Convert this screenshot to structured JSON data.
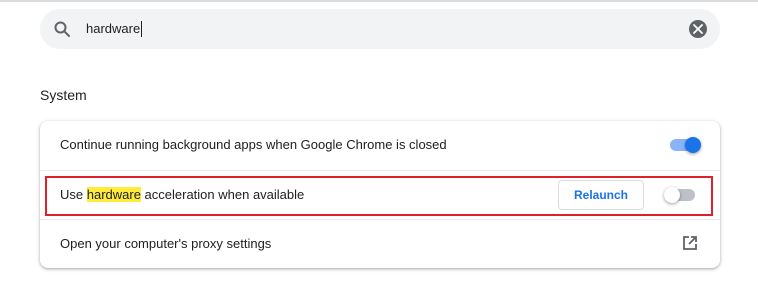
{
  "search": {
    "value": "hardware",
    "icon": "search-icon",
    "clear_icon": "close-icon"
  },
  "section": {
    "title": "System"
  },
  "settings": {
    "background_apps": {
      "label": "Continue running background apps when Google Chrome is closed",
      "enabled": true
    },
    "hardware_acceleration": {
      "label_before": "Use ",
      "label_highlight": "hardware",
      "label_after": " acceleration when available",
      "relaunch_label": "Relaunch",
      "enabled": false
    },
    "proxy": {
      "label": "Open your computer's proxy settings",
      "icon": "open-in-new-icon"
    }
  },
  "colors": {
    "accent": "#1a73e8",
    "highlight": "#ffeb3b",
    "annotation_box": "#e0202a"
  }
}
